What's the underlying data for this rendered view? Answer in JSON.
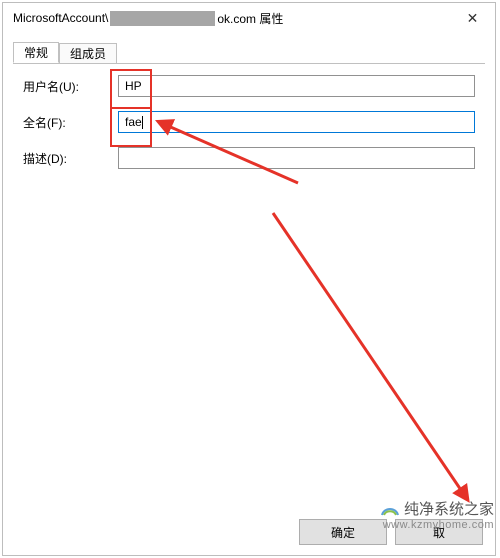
{
  "titlebar": {
    "prefix": "MicrosoftAccount\\",
    "suffix": "ok.com 属性",
    "close_glyph": "✕"
  },
  "tabs": {
    "general": "常规",
    "members": "组成员"
  },
  "form": {
    "username_label": "用户名(U):",
    "username_value": "HP",
    "fullname_label": "全名(F):",
    "fullname_value": "fae",
    "description_label": "描述(D):",
    "description_value": ""
  },
  "buttons": {
    "ok": "确定",
    "cancel": "取"
  },
  "watermark": {
    "line1": "纯净系统之家",
    "line2": "www.kzmyhome.com"
  },
  "annotations": {
    "highlight_color": "#e53228"
  }
}
